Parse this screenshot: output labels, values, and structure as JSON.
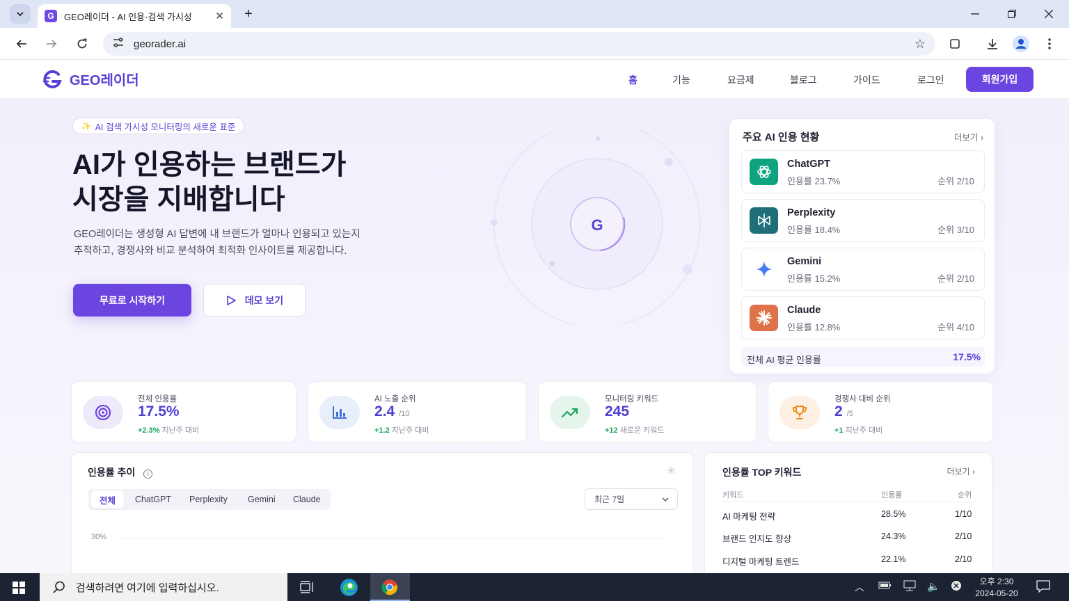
{
  "browser": {
    "tab_title": "GEO레이더 - AI 인용·검색 가시성",
    "tab_favicon": "G",
    "url": "georader.ai"
  },
  "nav": {
    "logo_text": "GEO레이더",
    "links": [
      "홈",
      "기능",
      "요금제",
      "블로그",
      "가이드",
      "로그인"
    ],
    "signup": "회원가입",
    "accent_color": "#6a45e0"
  },
  "hero": {
    "badge": "AI 검색 가시성 모니터링의 새로운 표준",
    "title_line1": "AI가 인용하는 브랜드가",
    "title_line2": "시장을 지배합니다",
    "desc_line1": "GEO레이더는 생성형 AI 답변에 내 브랜드가 얼마나 인용되고 있는지",
    "desc_line2": "추적하고, 경쟁사와 비교 분석하여 최적화 인사이트를 제공합니다.",
    "cta_primary": "무료로 시작하기",
    "cta_secondary": "데모 보기",
    "orbit_center": "G"
  },
  "ai_card": {
    "title": "주요 AI 인용 현황",
    "more": "더보기",
    "items": [
      {
        "name": "ChatGPT",
        "rate": "인용률 23.7%",
        "rank": "순위 2/10",
        "color": "#10a37f"
      },
      {
        "name": "Perplexity",
        "rate": "인용률 18.4%",
        "rank": "순위 3/10",
        "color": "#1f6f78"
      },
      {
        "name": "Gemini",
        "rate": "인용률 15.2%",
        "rank": "순위 2/10",
        "color": "#4a7bf7"
      },
      {
        "name": "Claude",
        "rate": "인용률 12.8%",
        "rank": "순위 4/10",
        "color": "#e0724a"
      }
    ],
    "avg_label": "전체 AI 평균 인용률",
    "avg_value": "17.5%"
  },
  "stats": [
    {
      "label": "전체 인용률",
      "value": "17.5%",
      "suffix": "",
      "change": "+2.3%",
      "change_note": "지난주 대비",
      "icon": "target-icon"
    },
    {
      "label": "AI 노출 순위",
      "value": "2.4",
      "suffix": "/10",
      "change": "+1.2",
      "change_note": "지난주 대비",
      "icon": "bar-chart-icon"
    },
    {
      "label": "모니터링 키워드",
      "value": "245",
      "suffix": "",
      "change": "+12",
      "change_note": "새로운 키워드",
      "icon": "trending-up-icon"
    },
    {
      "label": "경쟁사 대비 순위",
      "value": "2",
      "suffix": "/5",
      "change": "+1",
      "change_note": "지난주 대비",
      "icon": "trophy-icon"
    }
  ],
  "trend": {
    "title": "인용률 추이",
    "chips": [
      "전체",
      "ChatGPT",
      "Perplexity",
      "Gemini",
      "Claude"
    ],
    "period": "최근 7일",
    "y_tick": "30%"
  },
  "keywords": {
    "title": "인용률 TOP 키워드",
    "more": "더보기",
    "headers": [
      "키워드",
      "인용률",
      "순위"
    ],
    "rows": [
      [
        "AI 마케팅 전략",
        "28.5%",
        "1/10"
      ],
      [
        "브랜드 인지도 향상",
        "24.3%",
        "2/10"
      ],
      [
        "디지털 마케팅 트렌드",
        "22.1%",
        "2/10"
      ]
    ]
  },
  "taskbar": {
    "search_placeholder": "검색하려면 여기에 입력하십시오.",
    "time": "오후 2:30",
    "date": "2024-05-20"
  }
}
